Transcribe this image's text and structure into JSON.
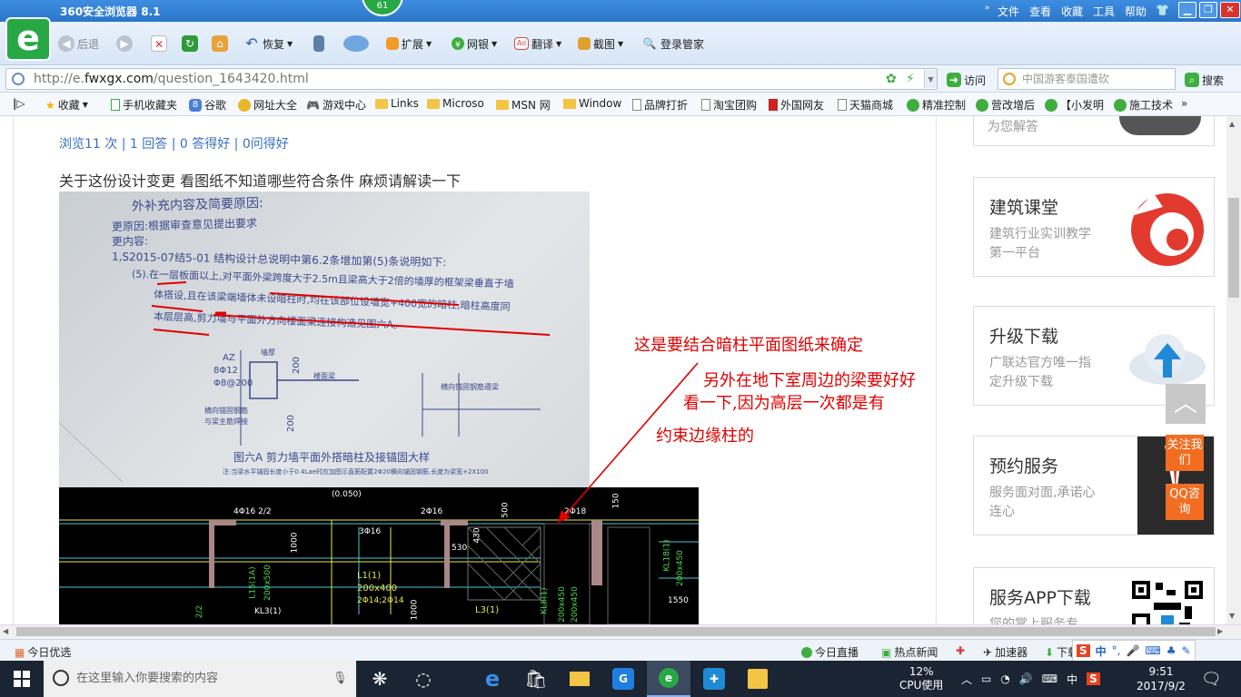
{
  "window": {
    "app_title": "360安全浏览器 8.1",
    "badge": "61",
    "menu": [
      "文件",
      "查看",
      "收藏",
      "工具",
      "帮助"
    ]
  },
  "toolbar": {
    "back": "后退",
    "restore": "恢复",
    "extend": "扩展",
    "bank": "网银",
    "translate": "翻译",
    "screenshot": "截图",
    "login": "登录管家"
  },
  "address": {
    "url_prefix": "http://e.",
    "url_domain": "fwxgx.com",
    "url_path": "/question_1643420.html",
    "go": "访问",
    "search_placeholder": "中国游客泰国遭砍",
    "search_button": "搜索"
  },
  "favorites": [
    "收藏",
    "手机收藏夹",
    "谷歌",
    "网址大全",
    "游戏中心",
    "Links",
    "Microso",
    "MSN 网",
    "Window",
    "品牌打折",
    "淘宝团购",
    "外国网友",
    "天猫商城",
    "精准控制",
    "营改增后",
    "【小发明",
    "施工技术"
  ],
  "question": {
    "stats": "浏览11 次 | 1 回答 | 0 答得好 | 0问得好",
    "text": "关于这份设计变更 看图纸不知道哪些符合条件 麻烦请解读一下"
  },
  "photo_text": {
    "line0": "外补充内容及简要原因:",
    "line1": "更原因:根据审查意见提出要求",
    "line2": "更内容:",
    "line3": "1,S2015-07结5-01  结构设计总说明中第6.2条增加第(5)条说明如下:",
    "line4": "(5).在一层板面以上,对平面外梁跨度大于2.5m且梁高大于2倍的墙厚的框架梁垂直于墙",
    "line5": "体搭设,且在该梁端墙体未设暗柱时,均在该部位设墙宽+400宽的暗柱,暗柱高度同",
    "line6": "本层层高,剪力墙与平面外方向楼面梁连接构造见图六A。",
    "az": "AZ",
    "az_r1": "8Φ12",
    "az_r2": "Φ8@200",
    "dim1": "200",
    "dim2": "200",
    "note1": "横向锚固钢筋",
    "note2": "与梁主筋焊接",
    "note3": "横向锚固钢筋遵梁",
    "wall": "墙厚",
    "floor_beam": "楼面梁",
    "caption": "图六A  剪力墙平面外搭暗柱及接锚固大样",
    "footnote": "注:当梁水平锚固长度小于0.4Lae时应加图示直筋配置2Φ20横向锚固钢筋,长度为梁宽+2X100"
  },
  "cad_text": {
    "t0": "(0.050)",
    "t1": "4Φ16 2/2",
    "t2": "2Φ16",
    "t3": "2Φ18",
    "t4": "3Φ16",
    "t5": "530",
    "t6": "L1(1)",
    "t7": "200x400",
    "t8": "2Φ14;2Φ14",
    "t9": "L3(1)",
    "t10": "KL3(1)",
    "t11": "1550",
    "t12": "1000",
    "t13": "1000",
    "t14": "500",
    "t15": "150",
    "t16": "430",
    "t17": "KL18(1)",
    "t18": "200x450",
    "t19": "L15(1A)",
    "t20": "200x500",
    "t21": "KL8(1)",
    "t22": "200x450",
    "t23": "2/2",
    "t24": "200x450"
  },
  "annotations": {
    "a1": "这是要结合暗柱平面图纸来确定",
    "a2": "另外在地下室周边的梁要好好",
    "a3": "看一下,因为高层一次都是有",
    "a4": "约束边缘柱的"
  },
  "sidebar": {
    "card0_desc": "为您解答",
    "card1_title": "建筑课堂",
    "card1_desc": "建筑行业实训教学第一平台",
    "card2_title": "升级下载",
    "card2_desc": "广联达官方唯一指定升级下载",
    "card3_title": "预约服务",
    "card3_desc": "服务面对面,承诺心连心",
    "card4_title": "服务APP下载",
    "card4_desc": "您的掌上服务专",
    "follow": "关注我们",
    "qq": "QQ咨询"
  },
  "status": {
    "today": "今日优选",
    "live": "今日直播",
    "news": "热点新闻",
    "accel": "加速器",
    "download": "下载"
  },
  "ime": {
    "lang": "中",
    "punct": "°,"
  },
  "taskbar": {
    "search_placeholder": "在这里输入你要搜索的内容",
    "cpu_pct": "12%",
    "cpu_label": "CPU使用",
    "lang": "中",
    "time": "9:51",
    "date": "2017/9/2"
  },
  "colors": {
    "brand_green": "#27a845",
    "annotation_red": "#e00000",
    "accent_orange": "#f26d21",
    "link_blue": "#3a6fc4"
  }
}
